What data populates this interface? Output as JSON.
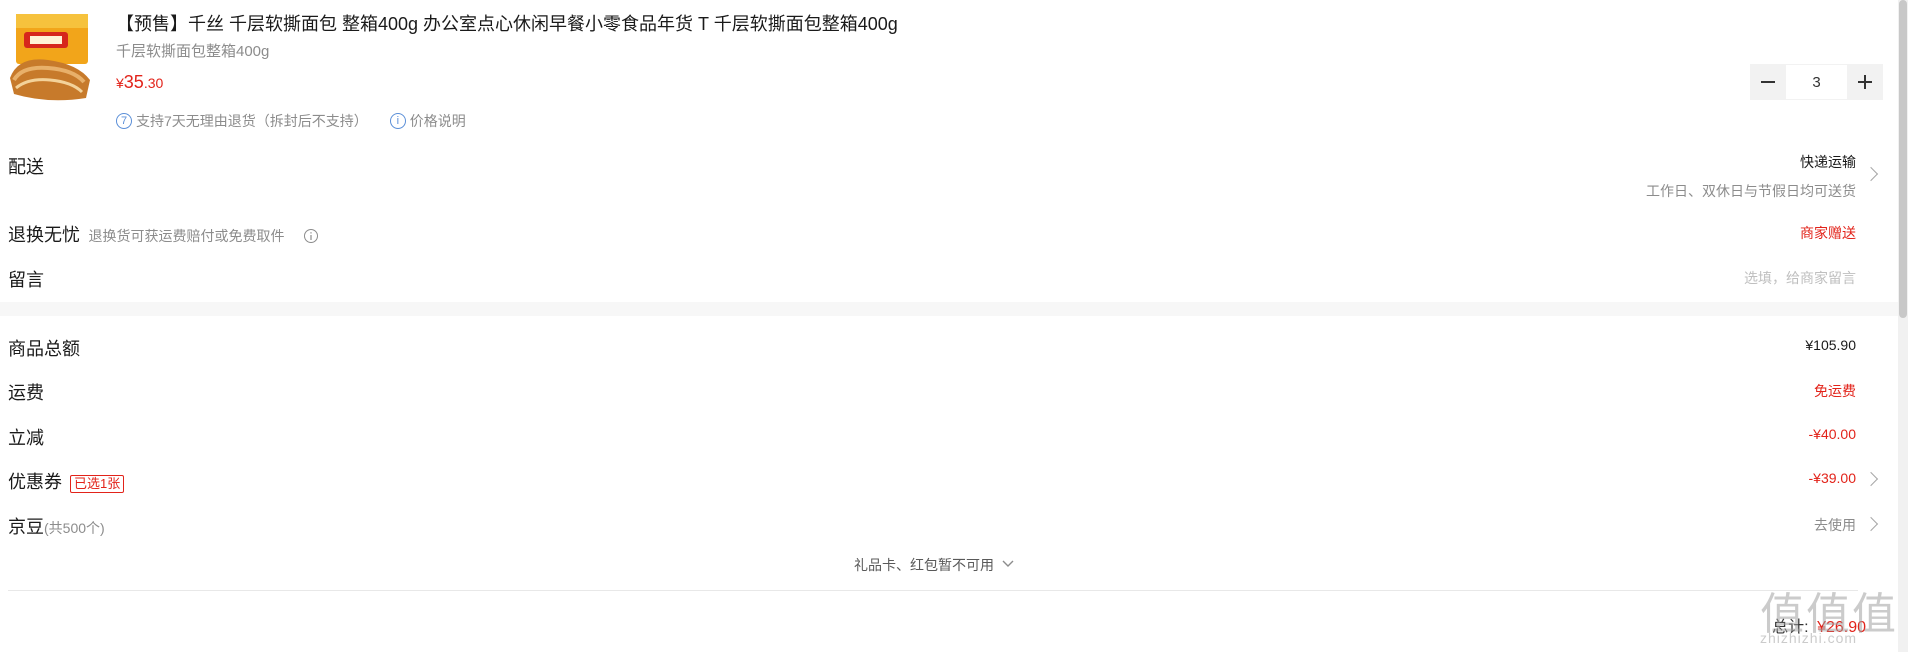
{
  "product": {
    "title": "【预售】千丝 千层软撕面包 整箱400g 办公室点心休闲早餐小零食品年货 T 千层软撕面包整箱400g",
    "spec": "千层软撕面包整箱400g",
    "price_currency": "¥",
    "price_main": "35",
    "price_decimal": ".30",
    "service_icon_text": "7",
    "service_text": "支持7天无理由退货（拆封后不支持）",
    "price_info_icon_text": "i",
    "price_info_text": "价格说明",
    "quantity": "3",
    "image_icon": "bread-box-image"
  },
  "delivery": {
    "label": "配送",
    "method": "快递运输",
    "note": "工作日、双休日与节假日均可送货"
  },
  "returns": {
    "label": "退换无忧",
    "desc": "退换货可获运费赔付或免费取件",
    "value": "商家赠送"
  },
  "message": {
    "label": "留言",
    "placeholder": "选填，给商家留言"
  },
  "summary": {
    "goods_total_label": "商品总额",
    "goods_total_value": "¥105.90",
    "shipping_label": "运费",
    "shipping_value": "免运费",
    "discount_label": "立减",
    "discount_value": "-¥40.00",
    "coupon_label": "优惠券",
    "coupon_tag": "已选1张",
    "coupon_value": "-¥39.00",
    "jingdou_label": "京豆",
    "jingdou_count": "(共500个)",
    "jingdou_action": "去使用",
    "giftcard_text": "礼品卡、红包暂不可用",
    "total_label": "总计:",
    "total_value": "¥26.90"
  },
  "watermark": {
    "big": "值值值",
    "small": "zhizhizhi.com"
  },
  "colors": {
    "accent_red": "#e2231a",
    "gray_text": "#8c8c8c",
    "blue_icon": "#5b8fd8"
  }
}
